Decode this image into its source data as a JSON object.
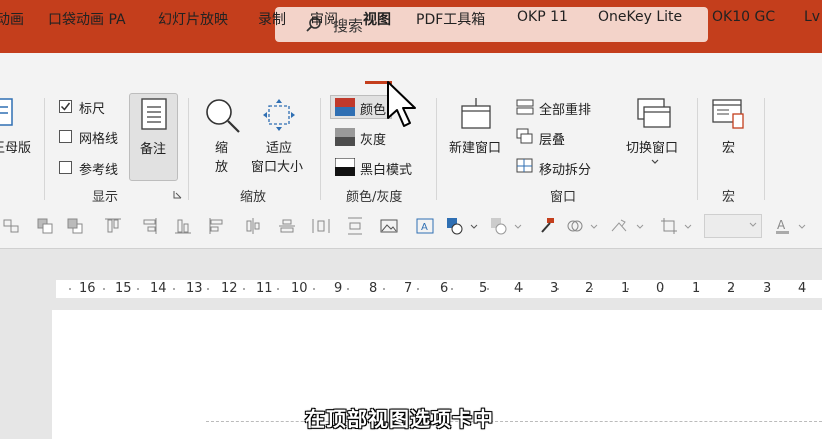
{
  "search": {
    "placeholder": "搜索"
  },
  "tabs": [
    {
      "label": "动画"
    },
    {
      "label": "口袋动画 PA"
    },
    {
      "label": "幻灯片放映"
    },
    {
      "label": "录制"
    },
    {
      "label": "审阅"
    },
    {
      "label": "视图",
      "active": true
    },
    {
      "label": "PDF工具箱"
    },
    {
      "label": "OKP 11"
    },
    {
      "label": "OneKey Lite"
    },
    {
      "label": "OK10 GC"
    },
    {
      "label": "Lv"
    }
  ],
  "ribbon": {
    "master_label": "王母版",
    "show": {
      "ruler": {
        "label": "标尺",
        "checked": true
      },
      "gridlines": {
        "label": "网格线",
        "checked": false
      },
      "guides": {
        "label": "参考线",
        "checked": false
      },
      "notes": "备注",
      "group_label": "显示"
    },
    "zoom": {
      "zoom_l1": "缩",
      "zoom_l2": "放",
      "fit_l1": "适应",
      "fit_l2": "窗口大小",
      "group_label": "缩放"
    },
    "color": {
      "color": "颜色",
      "grayscale": "灰度",
      "bw": "黑白模式",
      "group_label": "颜色/灰度"
    },
    "window": {
      "new_window": "新建窗口",
      "arrange_all": "全部重排",
      "cascade": "层叠",
      "move_split": "移动拆分",
      "switch_windows": "切换窗口",
      "group_label": "窗口"
    },
    "macro": {
      "macro": "宏",
      "group_label": "宏"
    }
  },
  "ruler_numbers": [
    "16",
    "15",
    "14",
    "13",
    "12",
    "11",
    "10",
    "9",
    "8",
    "7",
    "6",
    "5",
    "4",
    "3",
    "2",
    "1",
    "0",
    "1",
    "2",
    "3",
    "4"
  ],
  "subtitle": "在顶部视图选项卡中",
  "colors": {
    "accent": "#c43e1c",
    "search_bg": "#f3d3c9",
    "ribbon_bg": "#f3f3f3"
  }
}
